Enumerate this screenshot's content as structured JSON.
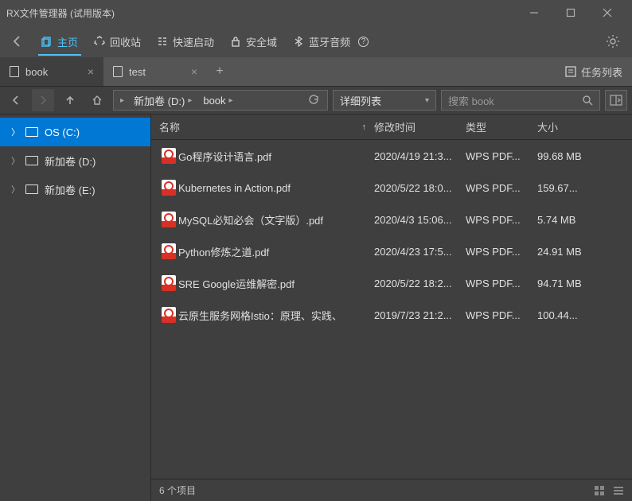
{
  "window": {
    "title": "RX文件管理器 (试用版本)"
  },
  "menubar": {
    "items": [
      {
        "label": "主页",
        "icon": "home-tab-icon",
        "active": true
      },
      {
        "label": "回收站",
        "icon": "recycle-icon"
      },
      {
        "label": "快速启动",
        "icon": "quicklaunch-icon"
      },
      {
        "label": "安全域",
        "icon": "security-icon"
      },
      {
        "label": "蓝牙音频",
        "icon": "bluetooth-icon",
        "help": true
      }
    ]
  },
  "tabs": {
    "items": [
      {
        "label": "book",
        "active": true
      },
      {
        "label": "test",
        "active": false
      }
    ],
    "tasklist_label": "任务列表"
  },
  "addressbar": {
    "breadcrumb": [
      "新加卷 (D:)",
      "book"
    ],
    "view_mode": "详细列表",
    "search_placeholder": "搜索 book"
  },
  "sidebar": {
    "items": [
      {
        "label": "OS (C:)",
        "selected": true
      },
      {
        "label": "新加卷 (D:)",
        "selected": false
      },
      {
        "label": "新加卷 (E:)",
        "selected": false
      }
    ]
  },
  "files": {
    "columns": {
      "name": "名称",
      "date": "修改时间",
      "type": "类型",
      "size": "大小"
    },
    "sort_col": "name",
    "sort_dir": "asc",
    "rows": [
      {
        "name": "Go程序设计语言.pdf",
        "date": "2020/4/19 21:3...",
        "type": "WPS PDF...",
        "size": "99.68 MB"
      },
      {
        "name": "Kubernetes in Action.pdf",
        "date": "2020/5/22 18:0...",
        "type": "WPS PDF...",
        "size": "159.67..."
      },
      {
        "name": "MySQL必知必会（文字版）.pdf",
        "date": "2020/4/3 15:06...",
        "type": "WPS PDF...",
        "size": "5.74 MB"
      },
      {
        "name": "Python修炼之道.pdf",
        "date": "2020/4/23 17:5...",
        "type": "WPS PDF...",
        "size": "24.91 MB"
      },
      {
        "name": "SRE  Google运维解密.pdf",
        "date": "2020/5/22 18:2...",
        "type": "WPS PDF...",
        "size": "94.71 MB"
      },
      {
        "name": "云原生服务网格Istio：原理、实践、",
        "date": "2019/7/23 21:2...",
        "type": "WPS PDF...",
        "size": "100.44..."
      }
    ]
  },
  "statusbar": {
    "count_text": "6 个项目"
  }
}
